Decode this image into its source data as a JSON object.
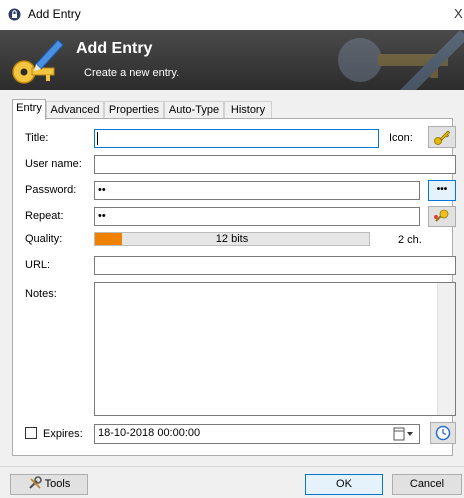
{
  "window": {
    "title": "Add Entry",
    "close_glyph": "X"
  },
  "banner": {
    "title": "Add Entry",
    "subtitle": "Create a new entry."
  },
  "tabs": [
    {
      "label": "Entry",
      "active": true
    },
    {
      "label": "Advanced",
      "active": false
    },
    {
      "label": "Properties",
      "active": false
    },
    {
      "label": "Auto-Type",
      "active": false
    },
    {
      "label": "History",
      "active": false
    }
  ],
  "form": {
    "title_label": "Title:",
    "title_value": "",
    "icon_label": "Icon:",
    "username_label": "User name:",
    "username_value": "",
    "password_label": "Password:",
    "password_value": "••",
    "show_password_glyph": "•••",
    "repeat_label": "Repeat:",
    "repeat_value": "••",
    "quality_label": "Quality:",
    "quality_text": "12 bits",
    "quality_fraction": 0.1,
    "quality_chars": "2 ch.",
    "url_label": "URL:",
    "url_value": "",
    "notes_label": "Notes:",
    "notes_value": "",
    "expires_label": "Expires:",
    "expires_checked": false,
    "expires_value": "18-10-2018 00:00:00"
  },
  "buttons": {
    "tools": "Tools",
    "ok": "OK",
    "cancel": "Cancel"
  },
  "colors": {
    "quality_fill": "#f08000",
    "focus_border": "#0078d7",
    "banner_bg": "#2c2c2c"
  }
}
